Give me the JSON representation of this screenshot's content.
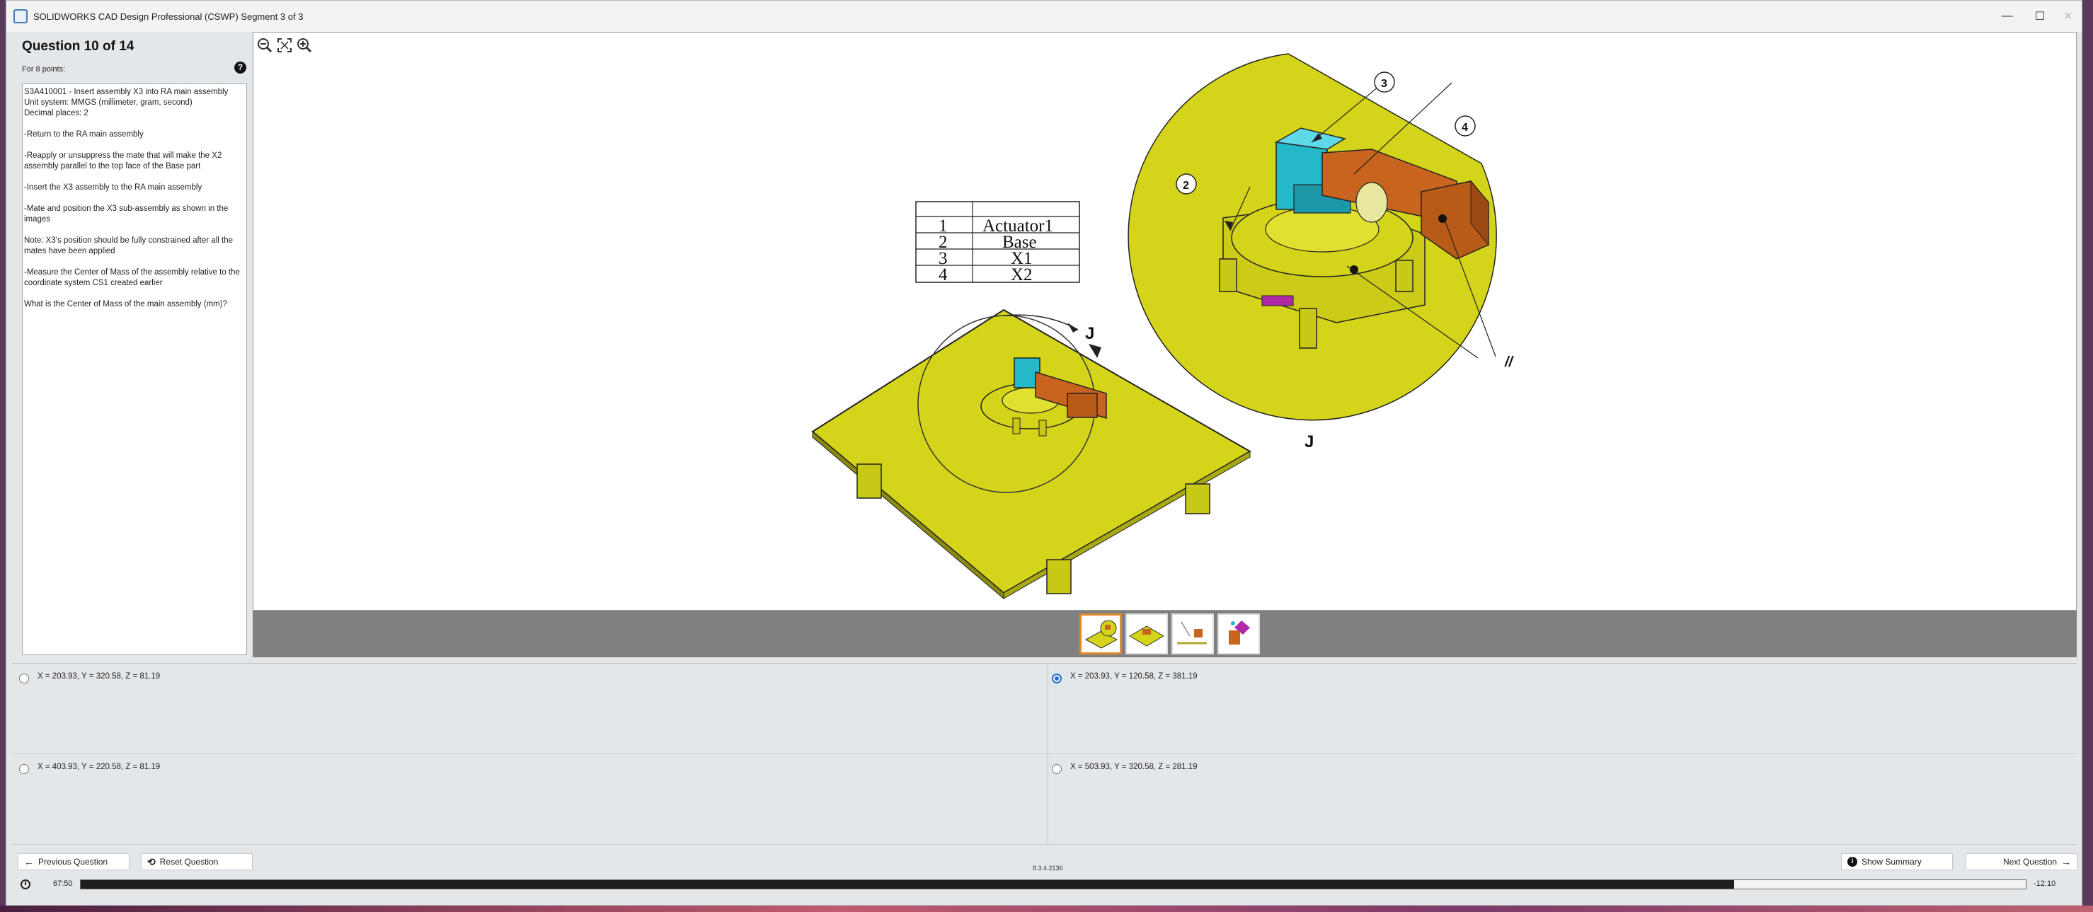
{
  "window": {
    "title": "SOLIDWORKS CAD Design Professional (CSWP) Segment 3 of 3",
    "minimize": "—",
    "maximize": "☐",
    "close": "✕"
  },
  "question": {
    "title": "Question 10 of 14",
    "points": "For 8 points:",
    "help": "?",
    "paragraphs": [
      "S3A410001 - Insert assembly X3 into RA main assembly\nUnit system: MMGS (millimeter, gram, second)\nDecimal places: 2",
      "-Return to the RA main assembly",
      "-Reapply or unsuppress the mate that will make the X2 assembly parallel to the top face of the Base part",
      "-Insert the X3 assembly to the RA main assembly",
      "-Mate and position the X3 sub-assembly as shown in the images",
      "Note: X3's position should be fully constrained after all the mates have been applied",
      "-Measure the Center of Mass of the assembly relative to the coordinate system CS1 created earlier",
      "What is the Center of Mass of the main assembly (mm)?"
    ]
  },
  "viewer": {
    "zoom_tools": [
      "zoom-out",
      "zoom-fit",
      "zoom-in"
    ],
    "bom": [
      {
        "num": "1",
        "name": "Actuator1"
      },
      {
        "num": "2",
        "name": "Base"
      },
      {
        "num": "3",
        "name": "X1"
      },
      {
        "num": "4",
        "name": "X2"
      }
    ],
    "detail_label": "J",
    "view_label": "J",
    "balloons": [
      "2",
      "3",
      "4"
    ],
    "parallel_mark": "//"
  },
  "answers": [
    {
      "label": "X = 203.93, Y = 320.58, Z = 81.19",
      "selected": false
    },
    {
      "label": "X = 203.93, Y = 120.58, Z = 381.19",
      "selected": true
    },
    {
      "label": "X = 403.93, Y = 220.58, Z = 81.19",
      "selected": false
    },
    {
      "label": "X = 503.93, Y = 320.58, Z = 281.19",
      "selected": false
    }
  ],
  "buttons": {
    "previous": "Previous Question",
    "reset": "Reset Question",
    "summary": "Show Summary",
    "next": "Next Question"
  },
  "version": "8.3.4.2136",
  "timer": {
    "elapsed": "67:50",
    "remaining": "-12:10",
    "progress": 0.85
  },
  "colors": {
    "accent": "#1c6fcf",
    "base_yellow": "#d4d41a",
    "actuator_cyan": "#25b8c8",
    "arm_orange": "#c8641e",
    "thumb_selected": "#e08a2a"
  }
}
